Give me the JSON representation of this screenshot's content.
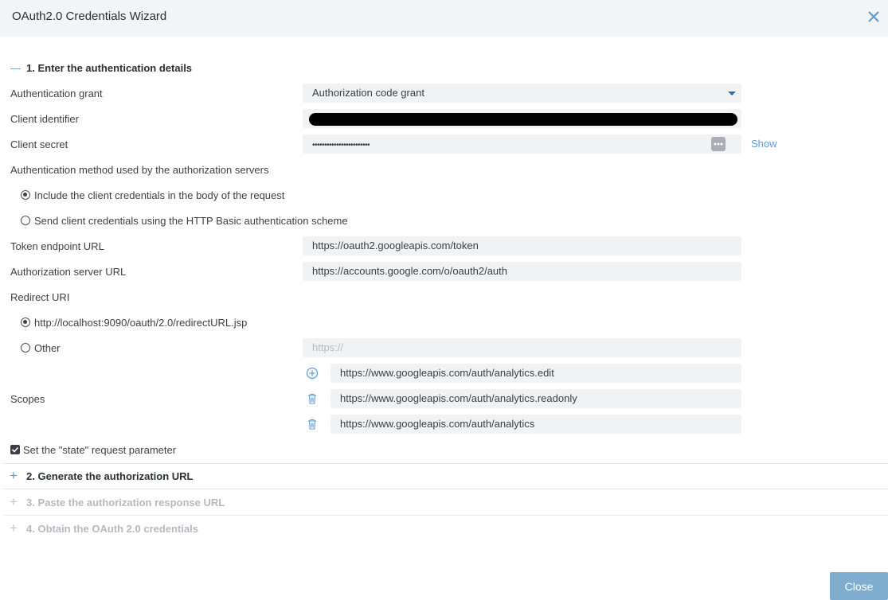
{
  "window": {
    "title": "OAuth2.0 Credentials Wizard"
  },
  "section1": {
    "toggle": "—",
    "heading": "1. Enter the authentication details",
    "auth_grant": {
      "label": "Authentication grant",
      "value": "Authorization code grant"
    },
    "client_id": {
      "label": "Client identifier"
    },
    "client_secret": {
      "label": "Client secret",
      "value": "••••••••••••••••••••••••",
      "show_label": "Show"
    },
    "auth_method": {
      "label": "Authentication method used by the authorization servers",
      "options": [
        {
          "label": "Include the client credentials in the body of the request",
          "selected": true
        },
        {
          "label": "Send client credentials using the HTTP Basic authentication scheme",
          "selected": false
        }
      ]
    },
    "token_endpoint": {
      "label": "Token endpoint URL",
      "value": "https://oauth2.googleapis.com/token"
    },
    "auth_server": {
      "label": "Authorization server URL",
      "value": "https://accounts.google.com/o/oauth2/auth"
    },
    "redirect_uri": {
      "label": "Redirect URI",
      "options": [
        {
          "label": "http://localhost:9090/oauth/2.0/redirectURL.jsp",
          "selected": true
        },
        {
          "label": "Other",
          "selected": false
        }
      ],
      "other_placeholder": "https://"
    },
    "scopes": {
      "label": "Scopes",
      "items": [
        "https://www.googleapis.com/auth/analytics.edit",
        "https://www.googleapis.com/auth/analytics.readonly",
        "https://www.googleapis.com/auth/analytics"
      ]
    },
    "state_param": {
      "label": "Set the \"state\" request parameter",
      "checked": true
    }
  },
  "section2": {
    "toggle": "+",
    "heading": "2. Generate the authorization URL"
  },
  "section3": {
    "toggle": "+",
    "heading": "3. Paste the authorization response URL"
  },
  "section4": {
    "toggle": "+",
    "heading": "4. Obtain the OAuth 2.0 credentials"
  },
  "footer": {
    "close_label": "Close"
  },
  "colors": {
    "accent": "#5b9bd5",
    "button": "#7fadcf",
    "field_bg": "#f1f2f3"
  }
}
